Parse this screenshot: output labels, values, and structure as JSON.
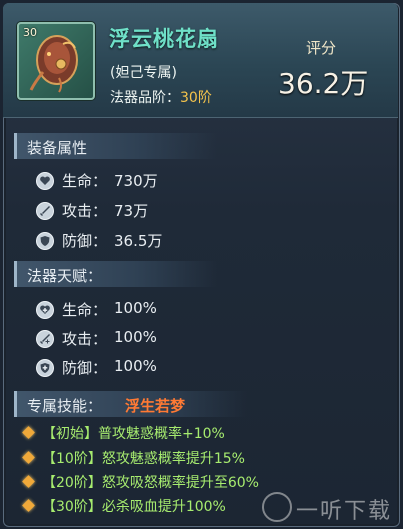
{
  "item": {
    "name": "浮云桃花扇",
    "owner": "(妲己专属)",
    "grade_label": "法器品阶：",
    "grade_value": "30阶",
    "level_badge": "30",
    "icon": "peach-blossom-fan-icon"
  },
  "score": {
    "label": "评分",
    "value": "36.2万"
  },
  "equip_attrs": {
    "title": "装备属性",
    "rows": [
      {
        "icon": "heart-icon",
        "label": "生命：",
        "value": "730万"
      },
      {
        "icon": "sword-icon",
        "label": "攻击：",
        "value": "73万"
      },
      {
        "icon": "shield-icon",
        "label": "防御：",
        "value": "36.5万"
      }
    ]
  },
  "talent": {
    "title": "法器天赋：",
    "rows": [
      {
        "icon": "heart-plus-icon",
        "label": "生命：",
        "value": "100%"
      },
      {
        "icon": "sword-plus-icon",
        "label": "攻击：",
        "value": "100%"
      },
      {
        "icon": "shield-plus-icon",
        "label": "防御：",
        "value": "100%"
      }
    ]
  },
  "skill": {
    "title": "专属技能：",
    "name": "浮生若梦",
    "lines": [
      "【初始】普攻魅惑概率+10%",
      "【10阶】怒攻魅惑概率提升15%",
      "【20阶】怒攻吸怒概率提升至60%",
      "【30阶】必杀吸血提升100%"
    ]
  },
  "watermark": "一听下载",
  "colors": {
    "name": "#6fe0c8",
    "grade": "#f3c34c",
    "skill_name": "#ff7a34",
    "skill_line": "#a7ec6f"
  }
}
